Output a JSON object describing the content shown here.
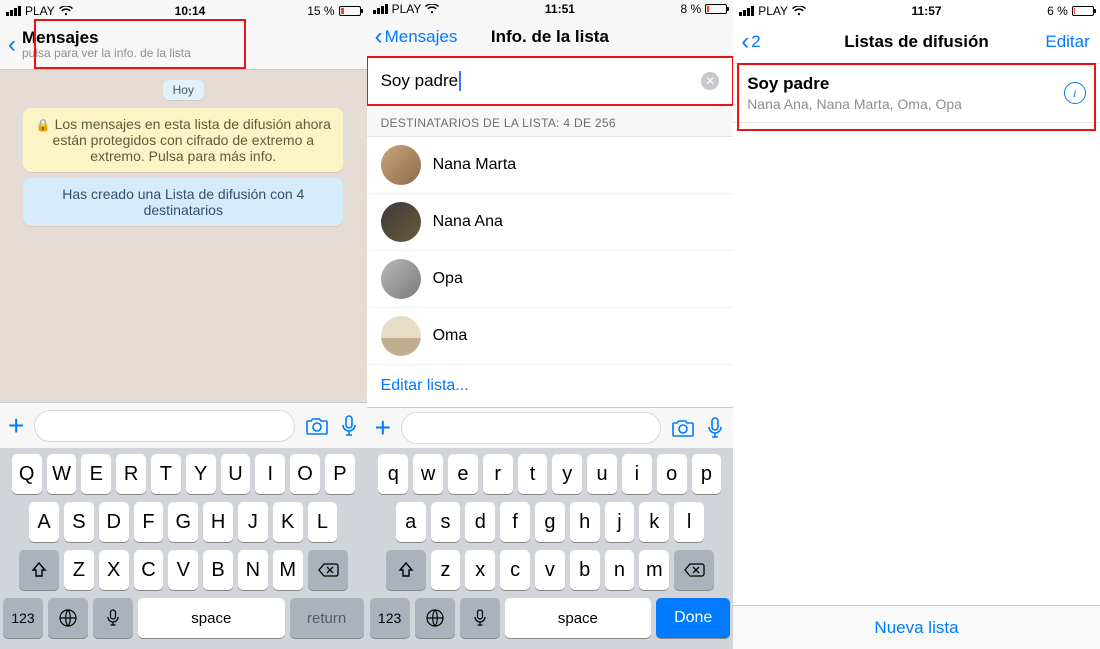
{
  "s1": {
    "status": {
      "carrier": "PLAY",
      "time": "10:14",
      "batt_pct": "15 %",
      "batt_fill": 15
    },
    "nav": {
      "title": "Mensajes",
      "subtitle": "pulsa para ver la info. de la lista"
    },
    "day": "Hoy",
    "encrypt": "Los mensajes en esta lista de difusión ahora están protegidos con cifrado de extremo a extremo. Pulsa para más info.",
    "created": "Has creado una Lista de difusión con 4 destinatarios",
    "kbd": {
      "r1": [
        "Q",
        "W",
        "E",
        "R",
        "T",
        "Y",
        "U",
        "I",
        "O",
        "P"
      ],
      "r2": [
        "A",
        "S",
        "D",
        "F",
        "G",
        "H",
        "J",
        "K",
        "L"
      ],
      "r3": [
        "Z",
        "X",
        "C",
        "V",
        "B",
        "N",
        "M"
      ],
      "numkey": "123",
      "space": "space",
      "ret": "return"
    }
  },
  "s2": {
    "status": {
      "carrier": "PLAY",
      "time": "11:51",
      "batt_pct": "8 %",
      "batt_fill": 8
    },
    "nav": {
      "back": "Mensajes",
      "title": "Info. de la lista"
    },
    "name": "Soy padre",
    "section": "DESTINATARIOS DE LA LISTA: 4 DE  256",
    "recips": [
      "Nana Marta",
      "Nana Ana",
      "Opa",
      "Oma"
    ],
    "edit": "Editar lista...",
    "kbd": {
      "r1": [
        "q",
        "w",
        "e",
        "r",
        "t",
        "y",
        "u",
        "i",
        "o",
        "p"
      ],
      "r2": [
        "a",
        "s",
        "d",
        "f",
        "g",
        "h",
        "j",
        "k",
        "l"
      ],
      "r3": [
        "z",
        "x",
        "c",
        "v",
        "b",
        "n",
        "m"
      ],
      "numkey": "123",
      "space": "space",
      "done": "Done"
    }
  },
  "s3": {
    "status": {
      "carrier": "PLAY",
      "time": "11:57",
      "batt_pct": "6 %",
      "batt_fill": 6
    },
    "nav": {
      "back": "2",
      "title": "Listas de difusión",
      "edit": "Editar"
    },
    "cell": {
      "title": "Soy padre",
      "sub": "Nana Ana, Nana Marta, Oma, Opa"
    },
    "newlist": "Nueva lista"
  }
}
